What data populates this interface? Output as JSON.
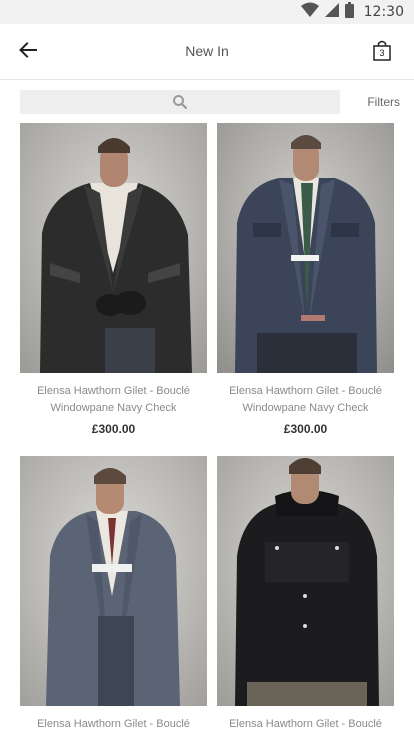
{
  "status_bar": {
    "time": "12:30"
  },
  "header": {
    "title": "New In",
    "bag_count": "3"
  },
  "search": {
    "placeholder": ""
  },
  "filters_label": "Filters",
  "products": [
    {
      "name_line1": "Elensa Hawthorn Gilet - Bouclé",
      "name_line2": "Windowpane Navy Check",
      "price": "£300.00"
    },
    {
      "name_line1": "Elensa Hawthorn Gilet - Bouclé",
      "name_line2": "Windowpane Navy Check",
      "price": "£300.00"
    },
    {
      "name_line1": "Elensa Hawthorn Gilet - Bouclé",
      "name_line2": "",
      "price": ""
    },
    {
      "name_line1": "Elensa Hawthorn Gilet - Bouclé",
      "name_line2": "",
      "price": ""
    }
  ],
  "colors": {
    "accent": "#333333",
    "muted_text": "#8a8a8a",
    "search_bg": "#eeeeee"
  }
}
